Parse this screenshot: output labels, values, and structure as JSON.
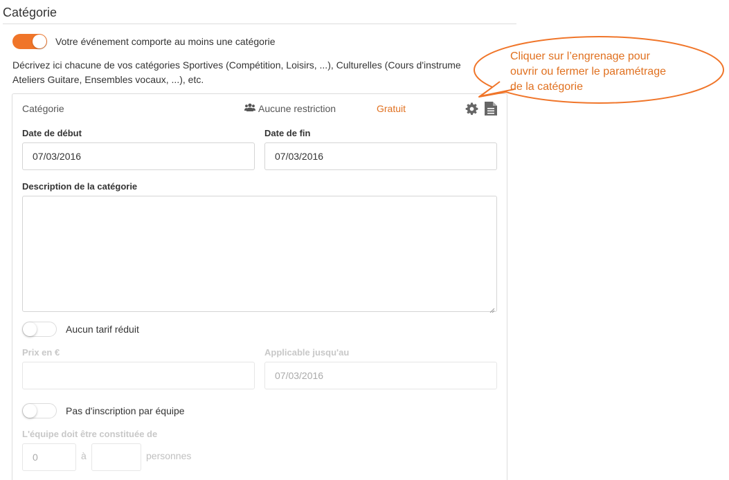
{
  "section": {
    "title": "Catégorie"
  },
  "main_toggle": {
    "label": "Votre événement comporte au moins une catégorie",
    "state": "on"
  },
  "description": {
    "line1": "Décrivez ici chacune de vos catégories Sportives (Compétition, Loisirs, ...), Culturelles (Cours d'instrume",
    "line2": "Ateliers Guitare, Ensembles vocaux, ...), etc."
  },
  "panel": {
    "name": "Catégorie",
    "restriction": "Aucune restriction",
    "price": "Gratuit",
    "start_date_label": "Date de début",
    "start_date_value": "07/03/2016",
    "end_date_label": "Date de fin",
    "end_date_value": "07/03/2016",
    "description_label": "Description de la catégorie",
    "reduced_rate_label": "Aucun tarif réduit",
    "price_label": "Prix en €",
    "applicable_label": "Applicable jusqu'au",
    "applicable_value": "07/03/2016",
    "team_toggle_label": "Pas d'inscription par équipe",
    "team_size_label": "L'équipe doit être constituée de",
    "team_min_value": "0",
    "team_to": "à",
    "team_persons": "personnes"
  },
  "callout": {
    "line1": "Cliquer sur l’engrenage pour",
    "line2": "ouvrir ou fermer le paramétrage",
    "line3": "de la catégorie"
  },
  "colors": {
    "accent": "#f07529",
    "callout": "#e0701f"
  },
  "icons": [
    "users-icon",
    "gear-icon",
    "document-icon"
  ]
}
